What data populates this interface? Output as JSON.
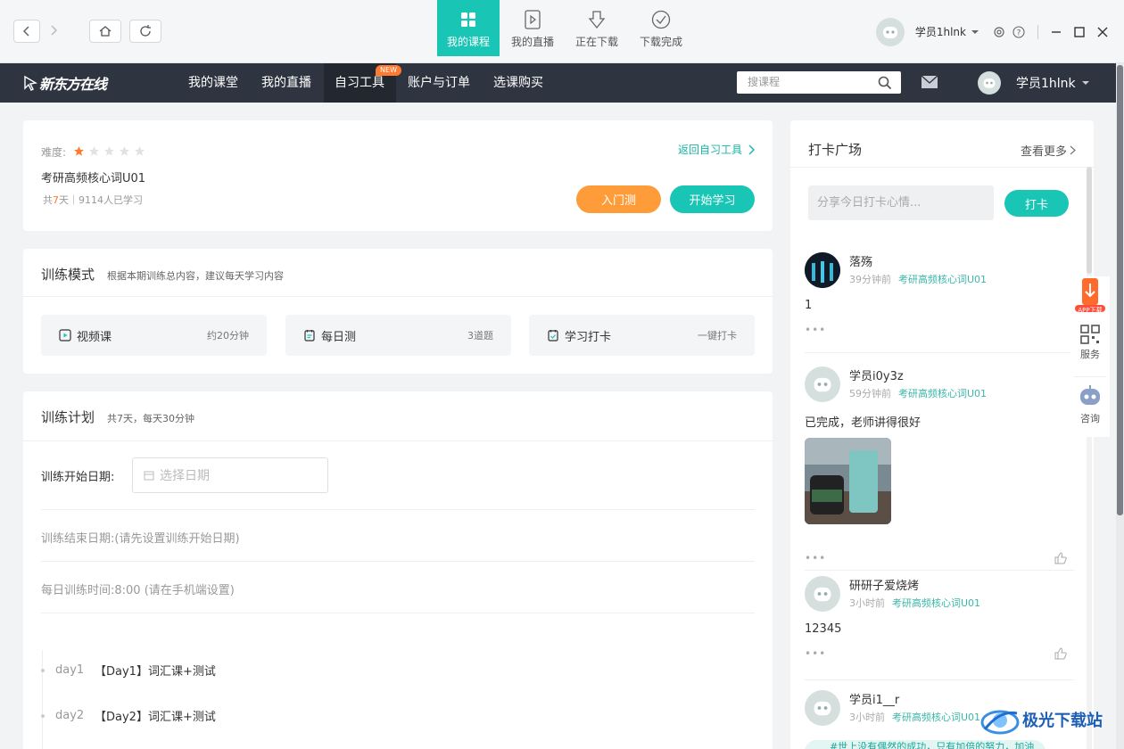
{
  "titlebar": {
    "tabs": [
      {
        "label": "我的课程",
        "icon": "grid-icon",
        "active": true
      },
      {
        "label": "我的直播",
        "icon": "play-doc-icon"
      },
      {
        "label": "正在下载",
        "icon": "download-icon"
      },
      {
        "label": "下载完成",
        "icon": "check-circle-icon"
      }
    ],
    "username": "学员1hlnk"
  },
  "nav": {
    "logo": "新东方在线",
    "items": [
      "我的课堂",
      "我的直播",
      "自习工具",
      "账户与订单",
      "选课购买"
    ],
    "new_badge": "NEW",
    "search_placeholder": "搜课程",
    "username": "学员1hlnk"
  },
  "course": {
    "difficulty_label": "难度:",
    "stars": 1,
    "stars_total": 5,
    "title": "考研高频核心词U01",
    "stats_prefix": "共",
    "days": "7",
    "stats_suffix": "天｜9114人已学习",
    "back_link": "返回自习工具",
    "btn_test": "入门测",
    "btn_start": "开始学习"
  },
  "mode": {
    "title": "训练模式",
    "subtitle": "根据本期训练总内容，建议每天学习内容",
    "items": [
      {
        "label": "视频课",
        "right": "约20分钟",
        "icon": "video-icon"
      },
      {
        "label": "每日测",
        "right": "3道题",
        "icon": "calendar-icon"
      },
      {
        "label": "学习打卡",
        "right": "一键打卡",
        "icon": "checkin-icon"
      }
    ]
  },
  "plan": {
    "title": "训练计划",
    "subtitle": "共7天，每天30分钟",
    "start_label": "训练开始日期:",
    "start_placeholder": "选择日期",
    "end_label": "训练结束日期:(请先设置训练开始日期)",
    "daily_label": "每日训练时间:8:00 (请在手机端设置)",
    "days": [
      {
        "day": "day1",
        "text": "【Day1】词汇课+测试"
      },
      {
        "day": "day2",
        "text": "【Day2】词汇课+测试"
      }
    ]
  },
  "square": {
    "title": "打卡广场",
    "more": "查看更多",
    "input_placeholder": "分享今日打卡心情...",
    "checkin_btn": "打卡",
    "posts": [
      {
        "name": "落殇",
        "time": "39分钟前",
        "course": "考研高频核心词U01",
        "text": "1"
      },
      {
        "name": "学员i0y3z",
        "time": "59分钟前",
        "course": "考研高频核心词U01",
        "text": "已完成，老师讲得很好"
      },
      {
        "name": "研研子爱烧烤",
        "time": "3小时前",
        "course": "考研高频核心词U01",
        "text": "12345"
      },
      {
        "name": "学员i1__r",
        "time": "3小时前",
        "course": "考研高频核心词U01",
        "text": "#世上没有偶然的成功，只有加倍的努力，加油"
      }
    ],
    "more_dots": "•••"
  },
  "side": {
    "app_label": "APP下载",
    "service": "服务",
    "consult": "咨询"
  },
  "watermark": "极光下载站"
}
